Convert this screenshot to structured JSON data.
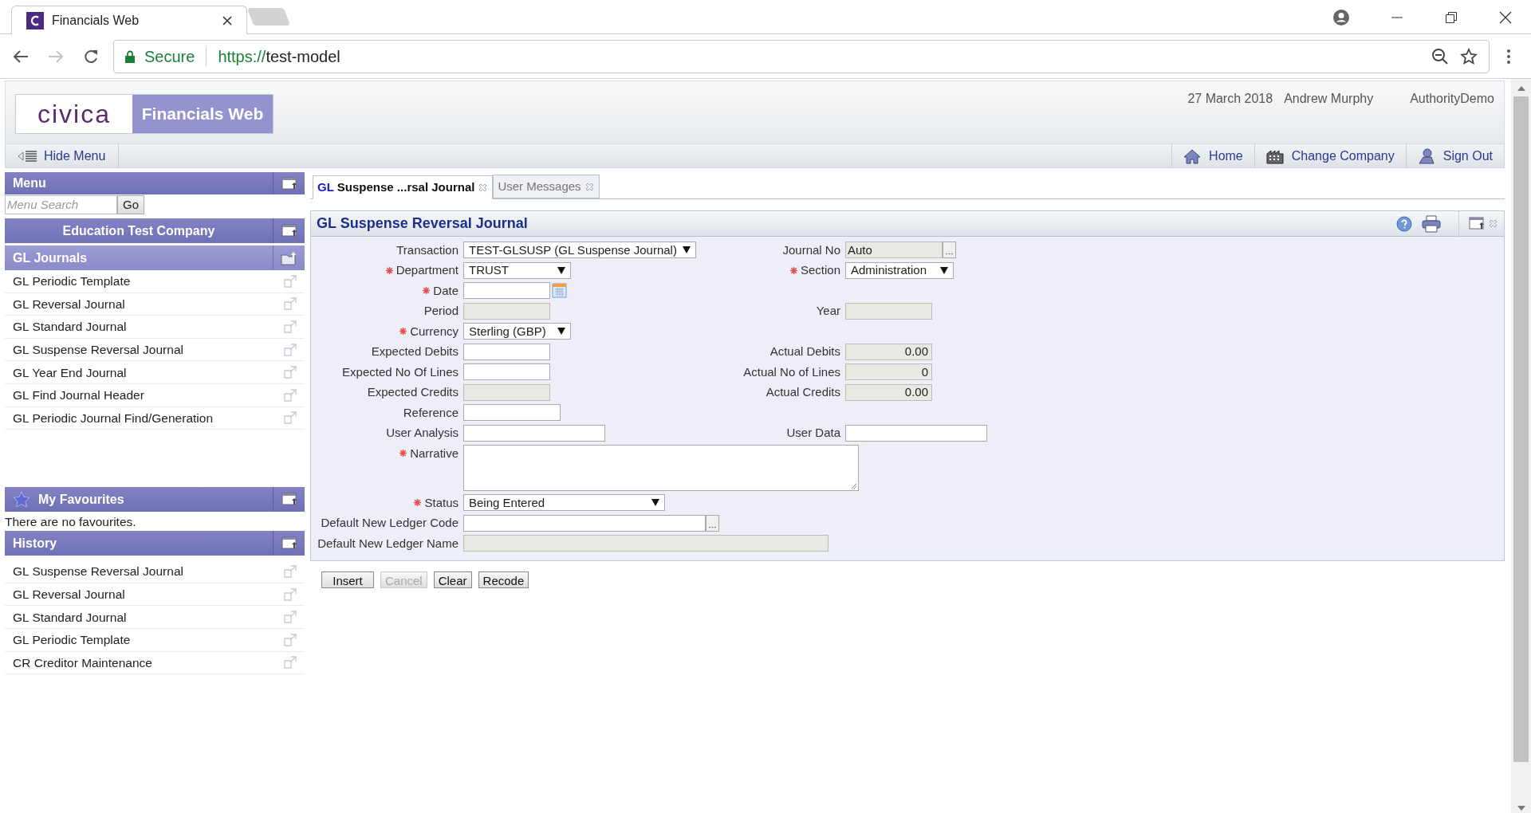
{
  "browser": {
    "tab_title": "Financials Web",
    "secure_label": "Secure",
    "url_scheme": "https://",
    "url_host": "test-model"
  },
  "header": {
    "logo": "civica",
    "product": "Financials Web",
    "date": "27 March 2018",
    "user": "Andrew Murphy",
    "site": "AuthorityDemo"
  },
  "toolbar": {
    "hide_menu": "Hide Menu",
    "links": [
      {
        "kind": "home",
        "label": "Home"
      },
      {
        "kind": "company",
        "label": "Change Company"
      },
      {
        "kind": "signout",
        "label": "Sign Out"
      }
    ]
  },
  "sidebar": {
    "menu_title": "Menu",
    "search_placeholder": "Menu Search",
    "go": "Go",
    "company": "Education Test Company",
    "group": {
      "title": "GL Journals",
      "items": [
        "GL Periodic Template",
        "GL Reversal Journal",
        "GL Standard Journal",
        "GL Suspense Reversal Journal",
        "GL Year End Journal",
        "GL Find Journal Header",
        "GL Periodic Journal Find/Generation"
      ]
    },
    "favourites": {
      "title": "My Favourites",
      "empty": "There are no favourites."
    },
    "history": {
      "title": "History",
      "items": [
        "GL Suspense Reversal Journal",
        "GL Reversal Journal",
        "GL Standard Journal",
        "GL Periodic Template",
        "CR Creditor Maintenance"
      ]
    }
  },
  "tabs": [
    {
      "prefix": "GL",
      "label": "Suspense ...rsal Journal",
      "selected": true
    },
    {
      "label": "User Messages",
      "selected": false
    }
  ],
  "form": {
    "title": "GL Suspense Reversal Journal",
    "rows": [
      {
        "left": {
          "label": "Transaction",
          "required": false,
          "kind": "select",
          "value": "TEST-GLSUSP (GL Suspense Journal)"
        },
        "right": {
          "label": "Journal No",
          "required": false,
          "kind": "lookup",
          "value": "Auto",
          "readonly": true
        }
      },
      {
        "left": {
          "label": "Department",
          "required": true,
          "kind": "select",
          "value": "TRUST"
        },
        "right": {
          "label": "Section",
          "required": true,
          "kind": "select",
          "value": "Administration"
        }
      },
      {
        "left": {
          "label": "Date",
          "required": true,
          "kind": "date"
        }
      },
      {
        "left": {
          "label": "Period",
          "required": false,
          "kind": "input",
          "readonly": true
        },
        "right": {
          "label": "Year",
          "required": false,
          "kind": "input",
          "readonly": true
        }
      },
      {
        "left": {
          "label": "Currency",
          "required": true,
          "kind": "select",
          "value": "Sterling (GBP)"
        }
      },
      {
        "left": {
          "label": "Expected Debits",
          "required": false,
          "kind": "input",
          "readonly": false
        },
        "right": {
          "label": "Actual Debits",
          "required": false,
          "kind": "input",
          "value": "0.00",
          "readonly": true
        }
      },
      {
        "left": {
          "label": "Expected No Of Lines",
          "required": false,
          "kind": "input",
          "readonly": false
        },
        "right": {
          "label": "Actual No of Lines",
          "required": false,
          "kind": "input",
          "value": "0",
          "readonly": true
        }
      },
      {
        "left": {
          "label": "Expected Credits",
          "required": false,
          "kind": "input",
          "readonly": true
        },
        "right": {
          "label": "Actual Credits",
          "required": false,
          "kind": "input",
          "value": "0.00",
          "readonly": true
        }
      },
      {
        "left": {
          "label": "Reference",
          "required": false,
          "kind": "input",
          "readonly": false
        }
      },
      {
        "left": {
          "label": "User Analysis",
          "required": false,
          "kind": "input",
          "readonly": false
        },
        "right": {
          "label": "User Data",
          "required": false,
          "kind": "input",
          "readonly": false
        }
      },
      {
        "left": {
          "label": "Narrative",
          "required": true,
          "kind": "textarea"
        }
      },
      {
        "left": {
          "label": "Status",
          "required": true,
          "kind": "select",
          "value": "Being Entered"
        }
      },
      {
        "left": {
          "label": "Default New Ledger Code",
          "required": false,
          "kind": "lookup",
          "readonly": false
        }
      },
      {
        "left": {
          "label": "Default New Ledger Name",
          "required": false,
          "kind": "input",
          "readonly": true
        }
      }
    ]
  },
  "buttons": [
    {
      "label": "Insert",
      "disabled": false
    },
    {
      "label": "Cancel",
      "disabled": true
    },
    {
      "label": "Clear",
      "disabled": false
    },
    {
      "label": "Recode",
      "disabled": false
    }
  ]
}
